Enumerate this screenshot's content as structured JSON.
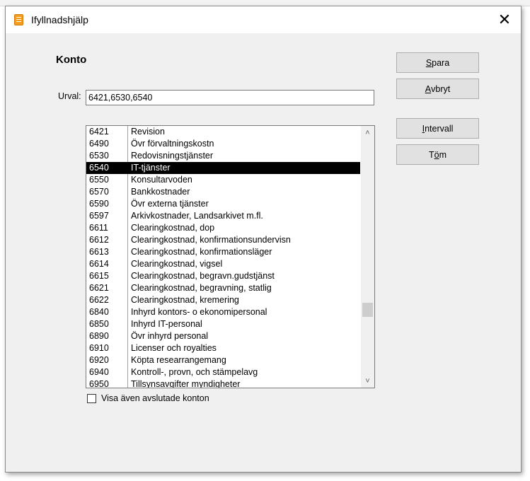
{
  "window": {
    "title": "Ifyllnadshjälp",
    "close_glyph": "✕"
  },
  "heading": "Konto",
  "urval": {
    "label": "Urval:",
    "value": "6421,6530,6540"
  },
  "buttons": {
    "save": {
      "first": "S",
      "rest": "para"
    },
    "cancel": {
      "first": "A",
      "rest": "vbryt"
    },
    "interval": {
      "first": "I",
      "rest": "ntervall"
    },
    "clear": {
      "pre": "T",
      "u": "ö",
      "post": "m"
    }
  },
  "accounts": [
    {
      "code": "6421",
      "name": "Revision"
    },
    {
      "code": "6490",
      "name": "Övr förvaltningskostn"
    },
    {
      "code": "6530",
      "name": "Redovisningstjänster"
    },
    {
      "code": "6540",
      "name": "IT-tjänster",
      "selected": true
    },
    {
      "code": "6550",
      "name": "Konsultarvoden"
    },
    {
      "code": "6570",
      "name": "Bankkostnader"
    },
    {
      "code": "6590",
      "name": "Övr externa tjänster"
    },
    {
      "code": "6597",
      "name": "Arkivkostnader, Landsarkivet m.fl."
    },
    {
      "code": "6611",
      "name": "Clearingkostnad, dop"
    },
    {
      "code": "6612",
      "name": "Clearingkostnad, konfirmationsundervisn"
    },
    {
      "code": "6613",
      "name": "Clearingkostnad, konfirmationsläger"
    },
    {
      "code": "6614",
      "name": "Clearingkostnad, vigsel"
    },
    {
      "code": "6615",
      "name": "Clearingkostnad, begravn.gudstjänst"
    },
    {
      "code": "6621",
      "name": "Clearingkostnad, begravning, statlig"
    },
    {
      "code": "6622",
      "name": "Clearingkostnad, kremering"
    },
    {
      "code": "6840",
      "name": "Inhyrd kontors- o ekonomipersonal"
    },
    {
      "code": "6850",
      "name": "Inhyrd IT-personal"
    },
    {
      "code": "6890",
      "name": "Övr inhyrd personal"
    },
    {
      "code": "6910",
      "name": "Licenser och royalties"
    },
    {
      "code": "6920",
      "name": "Köpta researrangemang"
    },
    {
      "code": "6940",
      "name": "Kontroll-, provn, och stämpelavg"
    },
    {
      "code": "6950",
      "name": "Tillsynsavgifter myndigheter"
    }
  ],
  "scrollbar": {
    "up_glyph": "˄",
    "down_glyph": "˅"
  },
  "checkbox": {
    "label": "Visa även avslutade konton",
    "checked": false
  },
  "colors": {
    "dialog_bg": "#f0f0f0",
    "button_bg": "#e1e1e1",
    "selection_bg": "#000000",
    "app_icon": "#f39c1e"
  }
}
